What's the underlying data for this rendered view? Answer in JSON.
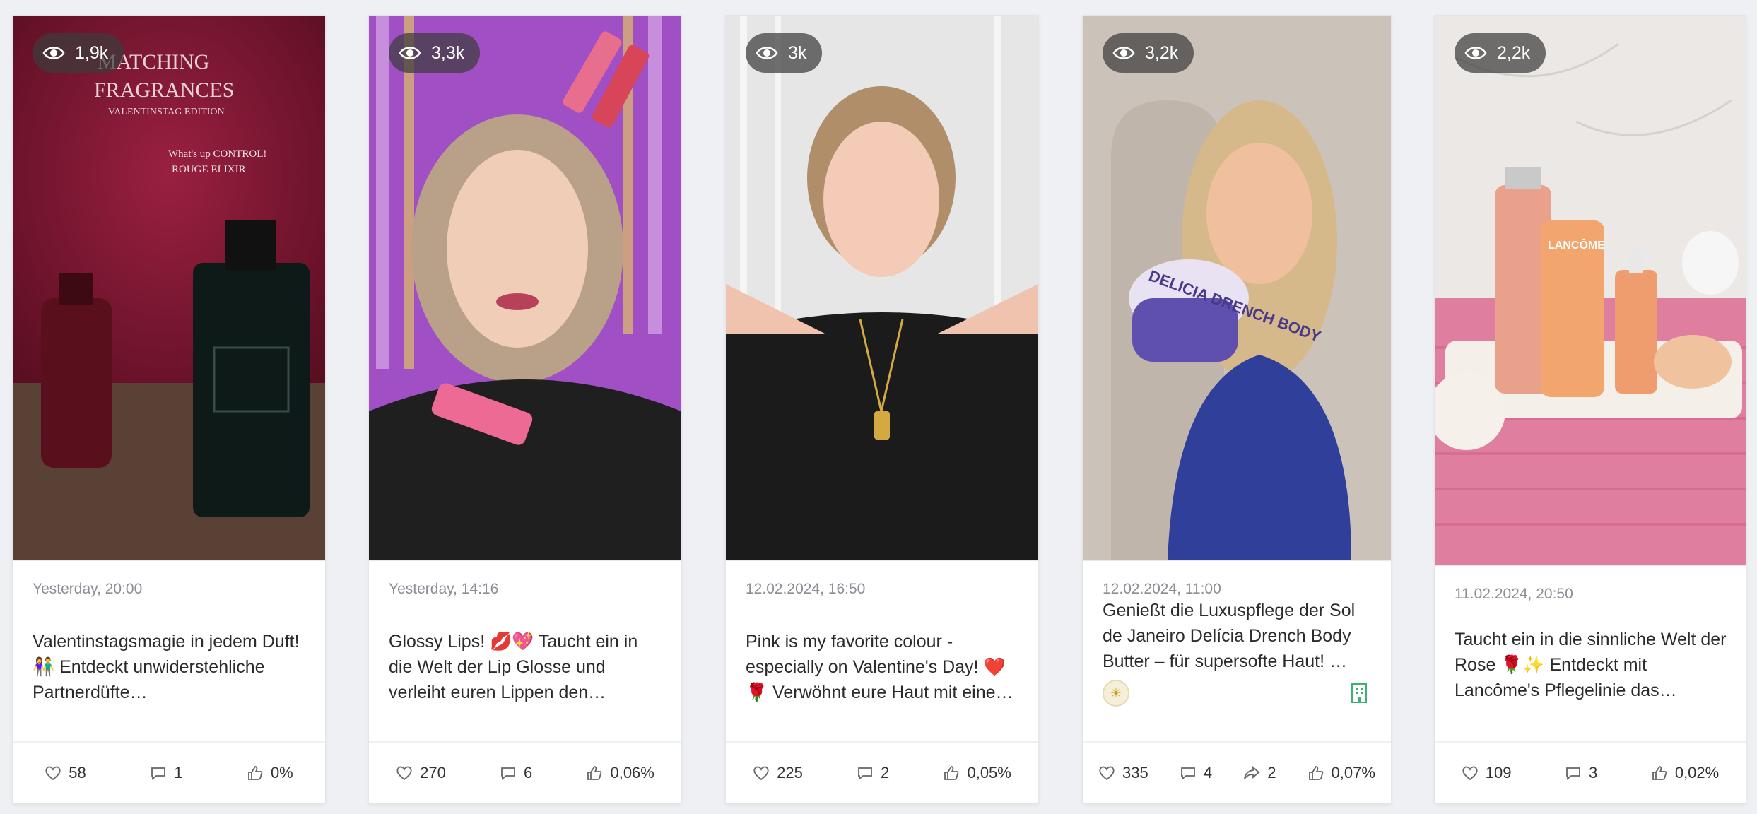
{
  "posts": [
    {
      "views": "1,9k",
      "date": "Yesterday, 20:00",
      "caption": "Valentinstagsmagie in jedem Duft! 👫 Entdeckt unwiderstehliche Partnerdüfte…",
      "likes": "58",
      "comments": "1",
      "engagement": "0%",
      "image_text": [
        "MATCHING",
        "FRAGRANCES",
        "VALENTINSTAG EDITION",
        "What's up CONTROL!",
        "ROUGE ELIXIR"
      ],
      "colors": {
        "bg": "#7a1530",
        "floor": "#6b4a3c"
      }
    },
    {
      "views": "3,3k",
      "date": "Yesterday, 14:16",
      "caption": "Glossy Lips! 💋💖 Taucht ein in die Welt der Lip Glosse und verleiht euren Lippen den…",
      "likes": "270",
      "comments": "6",
      "engagement": "0,06%",
      "colors": {
        "bg": "#b05ad0",
        "shirt": "#1e1e1e"
      }
    },
    {
      "views": "3k",
      "date": "12.02.2024, 16:50",
      "caption": "Pink is my favorite colour - especially on Valentine's Day! ❤️ 🌹 Verwöhnt eure Haut mit eine…",
      "likes": "225",
      "comments": "2",
      "engagement": "0,05%",
      "colors": {
        "bg": "#eaeaea",
        "shirt": "#1c1c1c"
      }
    },
    {
      "views": "3,2k",
      "date": "12.02.2024, 11:00",
      "caption": "Genießt die Luxuspflege der Sol de Janeiro Delícia Drench Body Butter – für supersofte Haut! …",
      "likes": "335",
      "comments": "4",
      "shares": "2",
      "engagement": "0,07%",
      "image_text": "DELICIA DRENCH BODY",
      "colors": {
        "bg": "#cfc7bf",
        "shirt": "#2f3f9a"
      }
    },
    {
      "views": "2,2k",
      "date": "11.02.2024, 20:50",
      "caption": "Taucht ein in die sinnliche Welt der Rose 🌹✨ Entdeckt mit Lancôme's Pflegelinie das…",
      "likes": "109",
      "comments": "3",
      "engagement": "0,02%",
      "image_text": "LANCÔME",
      "colors": {
        "bg": "#ece9e6",
        "towel": "#e58aa8"
      }
    }
  ]
}
